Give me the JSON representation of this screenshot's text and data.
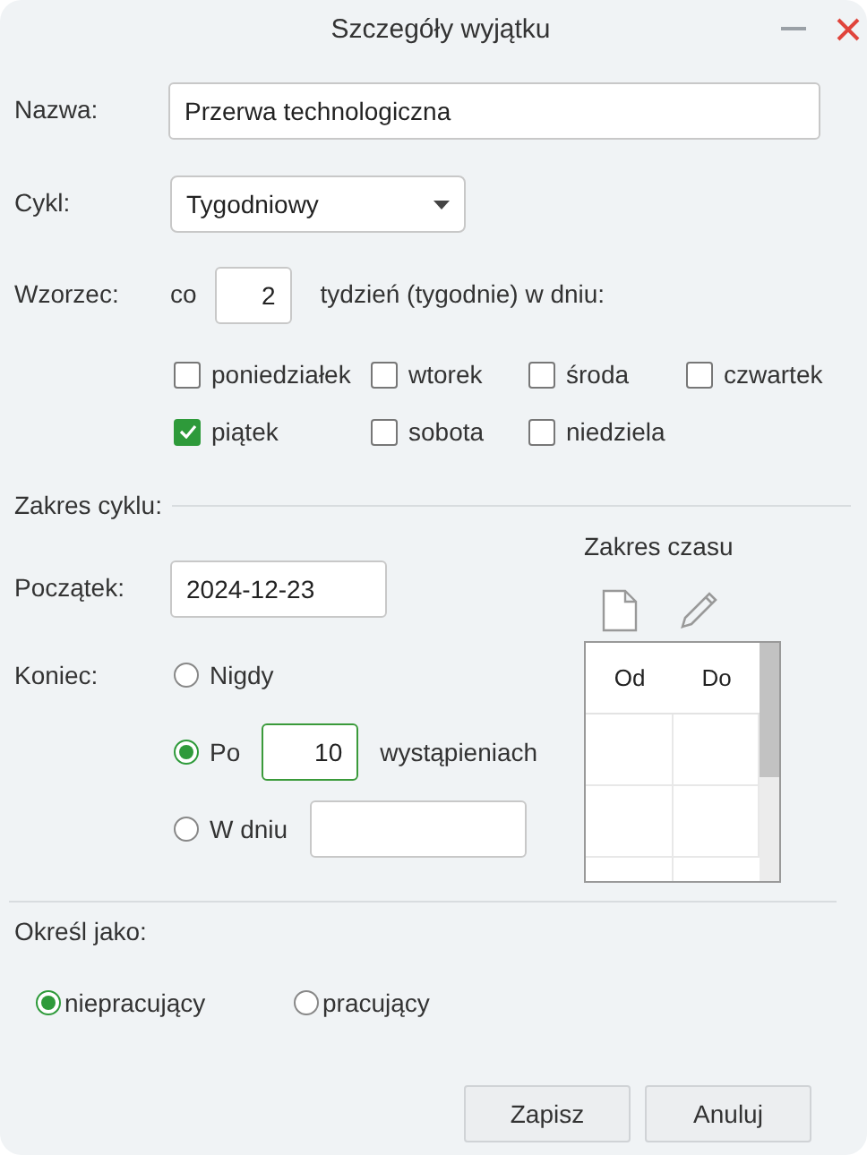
{
  "window": {
    "title": "Szczegóły wyjątku"
  },
  "name": {
    "label": "Nazwa:",
    "value": "Przerwa technologiczna"
  },
  "cycle": {
    "label": "Cykl:",
    "value": "Tygodniowy"
  },
  "pattern": {
    "label": "Wzorzec:",
    "prefix": "co",
    "value": "2",
    "suffix": "tydzień (tygodnie) w dniu:",
    "days": [
      {
        "label": "poniedziałek",
        "checked": false
      },
      {
        "label": "wtorek",
        "checked": false
      },
      {
        "label": "środa",
        "checked": false
      },
      {
        "label": "czwartek",
        "checked": false
      },
      {
        "label": "piątek",
        "checked": true
      },
      {
        "label": "sobota",
        "checked": false
      },
      {
        "label": "niedziela",
        "checked": false
      }
    ]
  },
  "range": {
    "title": "Zakres cyklu:",
    "start": {
      "label": "Początek:",
      "value": "2024-12-23"
    },
    "end": {
      "label": "Koniec:",
      "options": [
        {
          "kind": "plain",
          "label": "Nigdy",
          "selected": false
        },
        {
          "kind": "count",
          "label": "Po",
          "value": "10",
          "suffix": "wystąpieniach",
          "selected": true
        },
        {
          "kind": "date",
          "label": "W dniu",
          "selected": false
        }
      ]
    }
  },
  "time_range": {
    "title": "Zakres czasu",
    "columns": [
      "Od",
      "Do"
    ]
  },
  "mark_as": {
    "label": "Określ jako:",
    "options": [
      {
        "label": "niepracujący",
        "selected": true
      },
      {
        "label": "pracujący",
        "selected": false
      }
    ]
  },
  "buttons": [
    "Zapisz",
    "Anuluj"
  ]
}
